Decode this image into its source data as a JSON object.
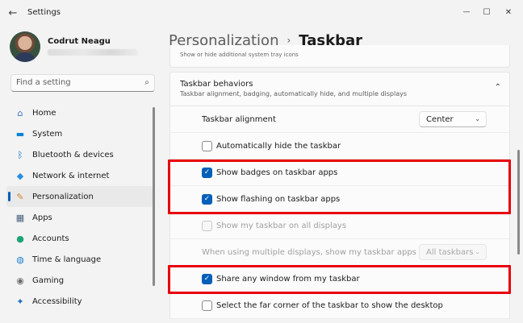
{
  "window": {
    "title": "Settings",
    "controls": {
      "minimize": "—",
      "maximize": "☐",
      "close": "✕"
    },
    "back_glyph": "←"
  },
  "profile": {
    "name": "Codrut Neagu"
  },
  "search": {
    "placeholder": "Find a setting",
    "icon": "⌕"
  },
  "sidebar": {
    "items": [
      {
        "label": "Home",
        "icon": "home-icon",
        "glyph": "⌂",
        "color": "#3c6fc4"
      },
      {
        "label": "System",
        "icon": "monitor-icon",
        "glyph": "▬",
        "color": "#0a83d6"
      },
      {
        "label": "Bluetooth & devices",
        "icon": "bluetooth-icon",
        "glyph": "ᛒ",
        "color": "#0067c0"
      },
      {
        "label": "Network & internet",
        "icon": "wifi-icon",
        "glyph": "◆",
        "color": "#2a8ee0"
      },
      {
        "label": "Personalization",
        "icon": "brush-icon",
        "glyph": "✎",
        "color": "#d9822b",
        "active": true
      },
      {
        "label": "Apps",
        "icon": "apps-icon",
        "glyph": "▦",
        "color": "#4b5f7c"
      },
      {
        "label": "Accounts",
        "icon": "person-icon",
        "glyph": "●",
        "color": "#1ea37a"
      },
      {
        "label": "Time & language",
        "icon": "globe-icon",
        "glyph": "◍",
        "color": "#1a7fd0"
      },
      {
        "label": "Gaming",
        "icon": "gamepad-icon",
        "glyph": "◉",
        "color": "#6d6d6d"
      },
      {
        "label": "Accessibility",
        "icon": "accessibility-icon",
        "glyph": "✦",
        "color": "#1c6fc2"
      }
    ]
  },
  "breadcrumb": {
    "parent": "Personalization",
    "separator": "›",
    "current": "Taskbar"
  },
  "top_card": {
    "text": "Show or hide additional system tray icons"
  },
  "section": {
    "title": "Taskbar behaviors",
    "subtitle": "Taskbar alignment, badging, automatically hide, and multiple displays",
    "chevron": "⌃"
  },
  "settings": {
    "alignment": {
      "label": "Taskbar alignment",
      "value": "Center",
      "chevron": "⌄"
    },
    "auto_hide": {
      "label": "Automatically hide the taskbar",
      "checked": false
    },
    "badges": {
      "label": "Show badges on taskbar apps",
      "checked": true
    },
    "flashing": {
      "label": "Show flashing on taskbar apps",
      "checked": true
    },
    "all_displays": {
      "label": "Show my taskbar on all displays",
      "checked": false,
      "disabled": true
    },
    "multi_display": {
      "label": "When using multiple displays, show my taskbar apps on",
      "value": "All taskbars",
      "chevron": "⌄",
      "disabled": true
    },
    "share_window": {
      "label": "Share any window from my taskbar",
      "checked": true
    },
    "far_corner": {
      "label": "Select the far corner of the taskbar to show the desktop",
      "checked": false
    }
  },
  "colors": {
    "accent": "#005fb8",
    "highlight": "#e8000b"
  },
  "check_glyph": "✓"
}
